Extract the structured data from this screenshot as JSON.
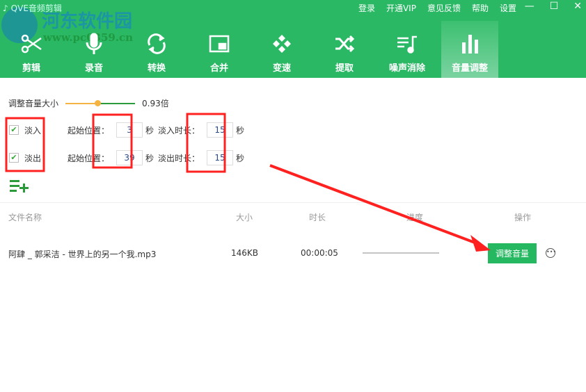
{
  "window": {
    "title": "QVE音频剪辑",
    "watermark": "河东软件园",
    "watermark_url": "www.pc0359.cn"
  },
  "topmenu": [
    "登录",
    "开通VIP",
    "意见反馈",
    "帮助",
    "设置"
  ],
  "tabs": [
    {
      "label": "剪辑",
      "icon": "scissors-icon"
    },
    {
      "label": "录音",
      "icon": "microphone-icon"
    },
    {
      "label": "转换",
      "icon": "convert-icon"
    },
    {
      "label": "合并",
      "icon": "merge-icon"
    },
    {
      "label": "变速",
      "icon": "speed-icon"
    },
    {
      "label": "提取",
      "icon": "shuffle-icon"
    },
    {
      "label": "噪声消除",
      "icon": "noise-icon"
    },
    {
      "label": "音量调整",
      "icon": "volume-bars-icon",
      "active": true
    }
  ],
  "volume": {
    "label": "调整音量大小",
    "value": "0.93倍",
    "slider_fraction": 0.46
  },
  "fade_in": {
    "label": "淡入",
    "checked": true,
    "start_label": "起始位置：",
    "start": "3",
    "unit": "秒",
    "dur_label": "淡入时长：",
    "duration": "15",
    "dur_unit": "秒"
  },
  "fade_out": {
    "label": "淡出",
    "checked": true,
    "start_label": "起始位置：",
    "start": "39",
    "unit": "秒",
    "dur_label": "淡出时长：",
    "duration": "15",
    "dur_unit": "秒"
  },
  "table": {
    "headers": [
      "文件名称",
      "大小",
      "时长",
      "进度",
      "操作"
    ],
    "rows": [
      {
        "name": "阿肆 _ 郭采洁 - 世界上的另一个我.mp3",
        "size": "146KB",
        "duration": "00:00:05",
        "progress": 0,
        "action": "调整音量"
      }
    ]
  },
  "colors": {
    "brand": "#2ab865",
    "annotation": "#ff2020"
  }
}
